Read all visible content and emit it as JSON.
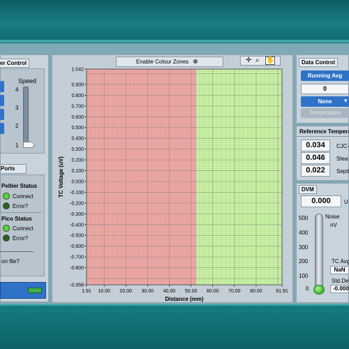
{
  "left_panel": {
    "title": "er Control",
    "speed_label": "Speed",
    "speed_ticks": [
      "4",
      "3",
      "2",
      "1"
    ],
    "speed_value": 1,
    "tab_ports": "Ports",
    "peltier_status": "Peltier Status",
    "pico_status": "Pico Status",
    "connect": "Connect",
    "error": "Error?",
    "save_question": "on file?"
  },
  "chart_header": {
    "enable_colour_zones": "Enable Colour Zones"
  },
  "chart_data": {
    "type": "line",
    "xlabel": "Distance (mm)",
    "ylabel": "TC Voltage (uV)",
    "xlim": [
      1.91,
      91.91
    ],
    "ylim": [
      -0.958,
      1.042
    ],
    "x_ticks": [
      1.91,
      10,
      20,
      30,
      40,
      50,
      60,
      70,
      80,
      91.91
    ],
    "x_tick_labels": [
      "1.91",
      "10.00",
      "20.00",
      "30.00",
      "40.00",
      "50.00",
      "60.00",
      "70.00",
      "80.00",
      "91.91"
    ],
    "y_ticks": [
      1.042,
      0.9,
      0.8,
      0.7,
      0.6,
      0.5,
      0.4,
      0.3,
      0.2,
      0.1,
      0,
      -0.1,
      -0.2,
      -0.3,
      -0.4,
      -0.5,
      -0.6,
      -0.7,
      -0.8,
      -0.958
    ],
    "y_tick_labels": [
      "1.042",
      "0.900",
      "0.800",
      "0.700",
      "0.600",
      "0.500",
      "0.400",
      "0.300",
      "0.200",
      "0.100",
      "0.000",
      "-0.100",
      "-0.200",
      "-0.300",
      "-0.400",
      "-0.500",
      "-0.600",
      "-0.700",
      "-0.800",
      "-0.958"
    ],
    "zones": [
      {
        "from": 1.91,
        "to": 52.5,
        "color": "#f1a3a3"
      },
      {
        "from": 52.5,
        "to": 91.91,
        "color": "#c9f2a2"
      }
    ],
    "grid": true,
    "series": []
  },
  "data_control": {
    "title": "Data Control",
    "running_avg": "Running Avg",
    "count": "0",
    "none": "None",
    "temperature": "Temperature"
  },
  "reference": {
    "title": "Reference Tempera",
    "values": [
      "0.034",
      "0.046",
      "0.022"
    ],
    "labels": [
      "CJC-",
      "Stea",
      "Septi"
    ]
  },
  "dvm": {
    "title": "DVM",
    "value": "0.000",
    "unit": "U",
    "noise_label": "Noise",
    "noise_unit": "nV",
    "ticks": [
      "500",
      "400",
      "300",
      "200",
      "100",
      "0"
    ],
    "level": 0,
    "tc_avg_label": "TC Avg",
    "tc_avg_value": "NaN",
    "std_dev_label": "Std.Dev",
    "std_dev_value": "-0.000"
  },
  "colors": {
    "accent_blue": "#2f73c8",
    "led_green": "#57d63a",
    "led_dark": "#2e5d26"
  }
}
